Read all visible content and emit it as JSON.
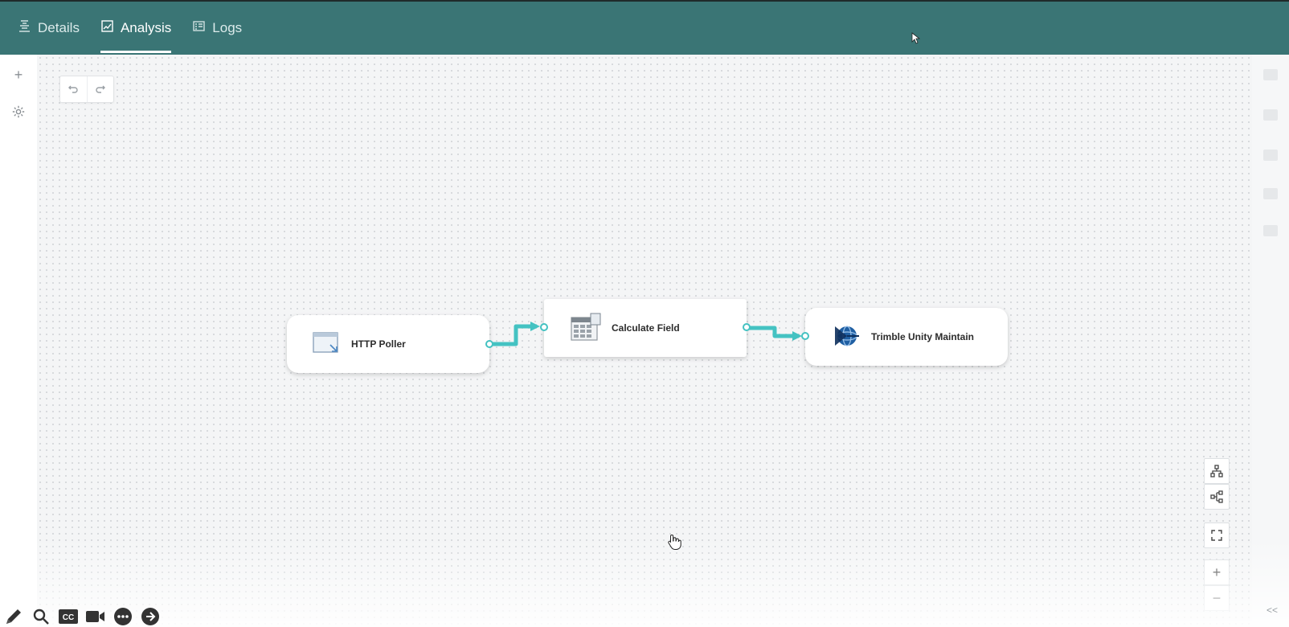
{
  "header": {
    "tabs": [
      {
        "label": "Details",
        "icon": "details-icon",
        "active": false
      },
      {
        "label": "Analysis",
        "icon": "analysis-icon",
        "active": true
      },
      {
        "label": "Logs",
        "icon": "logs-icon",
        "active": false
      }
    ]
  },
  "leftrail": {
    "add_icon": "plus-icon",
    "settings_icon": "gear-icon"
  },
  "canvas": {
    "undo_icon": "undo-icon",
    "redo_icon": "redo-icon",
    "nodes": [
      {
        "label": "HTTP Poller",
        "icon": "http-poller-icon"
      },
      {
        "label": "Calculate Field",
        "icon": "calculate-field-icon"
      },
      {
        "label": "Trimble Unity Maintain",
        "icon": "trimble-logo-icon"
      }
    ]
  },
  "controls": {
    "zoom_in": "+",
    "zoom_out": "−",
    "collapse": "<<"
  },
  "overlay_toolbar": {
    "cc_label": "CC"
  },
  "colors": {
    "header_bg": "#3a7575",
    "connector": "#44c2c2"
  }
}
